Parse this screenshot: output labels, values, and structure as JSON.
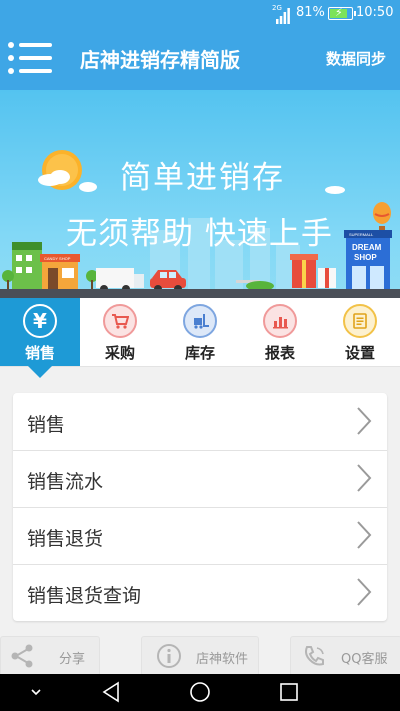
{
  "status_bar": {
    "network": "2G",
    "battery_percent": "81%",
    "battery_level": 0.81,
    "time": "10:50",
    "icons": [
      "signal-icon",
      "battery-charging-icon"
    ]
  },
  "header": {
    "title": "店神进销存精简版",
    "sync_label": "数据同步",
    "menu_icon": "menu-icon"
  },
  "banner": {
    "slogan_line1": "简单进销存",
    "slogan_line2": "无须帮助  快速上手",
    "shop_sign_small": "CANDY SHOP",
    "dream_shop_line1": "DREAM",
    "dream_shop_line2": "SHOP",
    "mall_sign": "SUPERMALL"
  },
  "tabs": [
    {
      "label": "销售",
      "icon": "yen-icon",
      "active": true
    },
    {
      "label": "采购",
      "icon": "cart-icon",
      "active": false
    },
    {
      "label": "库存",
      "icon": "forklift-icon",
      "active": false
    },
    {
      "label": "报表",
      "icon": "chart-icon",
      "active": false
    },
    {
      "label": "设置",
      "icon": "document-icon",
      "active": false
    }
  ],
  "menu_items": [
    {
      "label": "销售"
    },
    {
      "label": "销售流水"
    },
    {
      "label": "销售退货"
    },
    {
      "label": "销售退货查询"
    }
  ],
  "bottom_actions": {
    "share": "分享",
    "software": "店神软件",
    "support": "QQ客服"
  },
  "colors": {
    "primary": "#3ea6e6",
    "active_tab": "#1e9ad6",
    "background": "#f1f1f1"
  }
}
